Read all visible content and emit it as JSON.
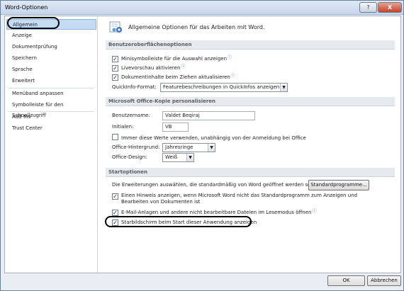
{
  "window": {
    "title": "Word-Optionen",
    "help_label": "?",
    "close_label": "X"
  },
  "sidebar": {
    "items": [
      {
        "label": "Allgemein",
        "active": true
      },
      {
        "label": "Anzeige"
      },
      {
        "label": "Dokumentprüfung"
      },
      {
        "label": "Speichern"
      },
      {
        "label": "Sprache"
      },
      {
        "label": "Erweitert"
      },
      {
        "label": "Menüband anpassen"
      },
      {
        "label": "Symbolleiste für den Schnellzugriff"
      },
      {
        "label": "Add-Ins"
      },
      {
        "label": "Trust Center"
      }
    ]
  },
  "main": {
    "intro": "Allgemeine Optionen für das Arbeiten mit Word.",
    "ui_section": {
      "title": "Benutzeroberflächenoptionen",
      "options": [
        {
          "label": "Minisymbolleiste für die Auswahl anzeigen",
          "checked": true,
          "info": true
        },
        {
          "label": "Livevorschau aktivieren",
          "checked": true,
          "info": true
        },
        {
          "label": "Dokumentinhalte beim Ziehen aktualisieren",
          "checked": true,
          "info": true
        }
      ],
      "quickinfo_label": "QuickInfo-Format:",
      "quickinfo_value": "Featurebeschreibungen in QuickInfos anzeigen"
    },
    "personalize_section": {
      "title": "Microsoft Office-Kopie personalisieren",
      "username_label": "Benutzername:",
      "username_value": "Valdet Beqiraj",
      "initials_label": "Initialen:",
      "initials_value": "VB",
      "always_use_label": "Immer diese Werte verwenden, unabhängig von der Anmeldung bei Office",
      "background_label": "Office-Hintergrund:",
      "background_value": "Jahresringe",
      "design_label": "Office-Design:",
      "design_value": "Weiß"
    },
    "start_section": {
      "title": "Startoptionen",
      "extensions_text": "Die Erweiterungen auswählen, die standardmäßig von Word geöffnet werden sollen:",
      "default_programs_button": "Standardprogramme...",
      "notify_label": "Einen Hinweis anzeigen, wenn Microsoft Word nicht das Standardprogramm zum Anzeigen und Bearbeiten von Dokumenten ist",
      "email_label": "E-Mail-Anlagen und andere nicht bearbeitbare Dateien im Lesemodus öffnen",
      "startscreen_label": "Starbildschirm beim Start dieser Anwendung anzeigen"
    }
  },
  "footer": {
    "ok_label": "OK",
    "cancel_label": "Abbrechen"
  }
}
